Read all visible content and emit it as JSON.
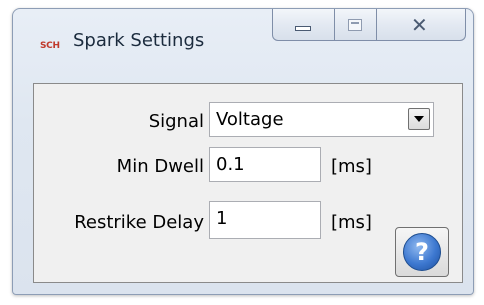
{
  "window": {
    "title": "Spark Settings",
    "app_icon_text": "SCH"
  },
  "caption": {
    "minimize_icon": "minimize-icon",
    "maximize_icon": "maximize-icon",
    "close_icon": "close-icon",
    "close_glyph": "✕"
  },
  "form": {
    "signal": {
      "label": "Signal",
      "value": "Voltage"
    },
    "min_dwell": {
      "label": "Min Dwell",
      "value": "0.1",
      "unit": "[ms]"
    },
    "restrike_delay": {
      "label": "Restrike Delay",
      "value": "1",
      "unit": "[ms]"
    }
  },
  "help": {
    "icon": "help-icon",
    "glyph": "?"
  },
  "colors": {
    "title_text": "#1b2b3d",
    "help_blue": "#3d78d0",
    "app_icon_red": "#c0392b"
  }
}
